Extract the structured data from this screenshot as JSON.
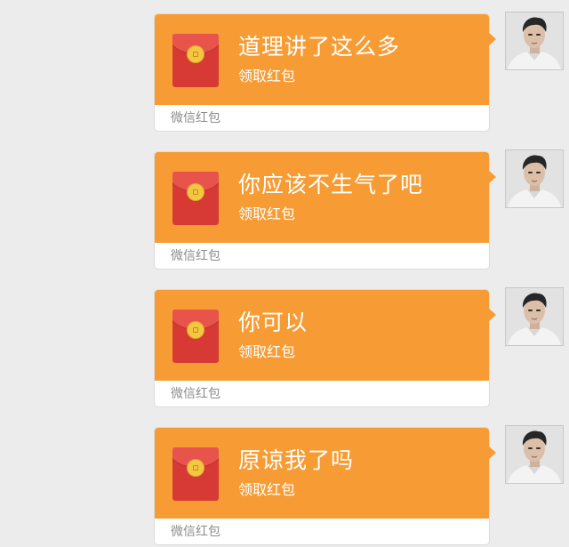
{
  "messages": [
    {
      "title": "道理讲了这么多",
      "subtitle": "领取红包",
      "footer": "微信红包"
    },
    {
      "title": "你应该不生气了吧",
      "subtitle": "领取红包",
      "footer": "微信红包"
    },
    {
      "title": "你可以",
      "subtitle": "领取红包",
      "footer": "微信红包"
    },
    {
      "title": "原谅我了吗",
      "subtitle": "领取红包",
      "footer": "微信红包"
    }
  ],
  "colors": {
    "background": "#ececec",
    "bubble": "#f79c34",
    "envelope": "#d73a35",
    "seal": "#f4c742"
  },
  "icons": {
    "envelope": "red-envelope-icon",
    "avatar": "avatar-photo"
  }
}
